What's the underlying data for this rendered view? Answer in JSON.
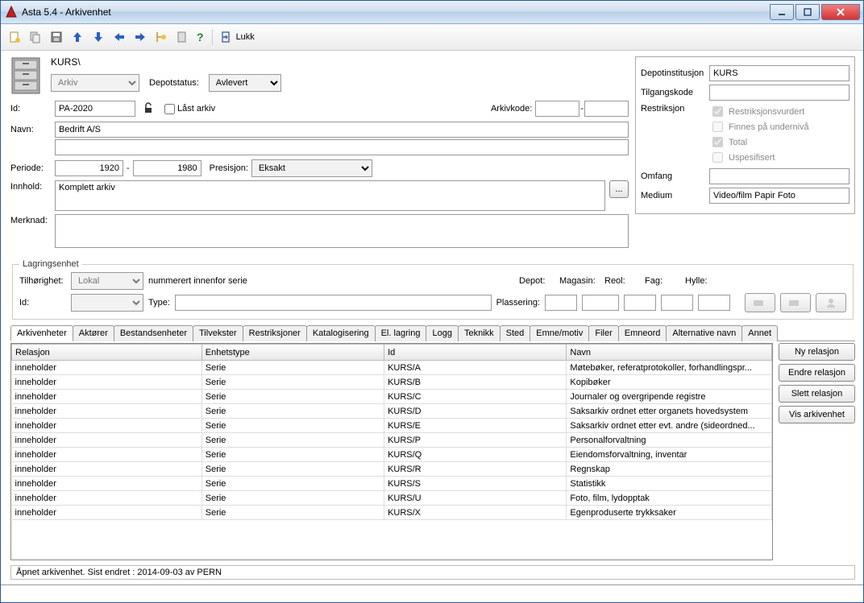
{
  "window": {
    "title": "Asta 5.4 - Arkivenhet"
  },
  "toolbar": {
    "close_label": "Lukk"
  },
  "main": {
    "breadcrumb": "KURS\\",
    "type_select": "Arkiv",
    "depotstatus_label": "Depotstatus:",
    "depotstatus_value": "Avlevert",
    "id_label": "Id:",
    "id_value": "PA-2020",
    "locked_label": "Låst arkiv",
    "arkivkode_label": "Arkivkode:",
    "navn_label": "Navn:",
    "navn_value": "Bedrift A/S",
    "periode_label": "Periode:",
    "periode_from": "1920",
    "periode_sep": "-",
    "periode_to": "1980",
    "presisjon_label": "Presisjon:",
    "presisjon_value": "Eksakt",
    "innhold_label": "Innhold:",
    "innhold_value": "Komplett arkiv",
    "merknad_label": "Merknad:"
  },
  "right": {
    "depotinst_label": "Depotinstitusjon",
    "depotinst_value": "KURS",
    "tilgang_label": "Tilgangskode",
    "restriksjon_label": "Restriksjon",
    "chk_restr": "Restriksjonsvurdert",
    "chk_finnes": "Finnes på undernivå",
    "chk_total": "Total",
    "chk_uspes": "Uspesifisert",
    "omfang_label": "Omfang",
    "medium_label": "Medium",
    "medium_value": "Video/film Papir Foto"
  },
  "lagring": {
    "legend": "Lagringsenhet",
    "tilh_label": "Tilhørighet:",
    "tilh_value": "Lokal",
    "nummerert": "nummerert innenfor serie",
    "id_label": "Id:",
    "type_label": "Type:",
    "plassering_label": "Plassering:",
    "depot_label": "Depot:",
    "magasin_label": "Magasin:",
    "reol_label": "Reol:",
    "fag_label": "Fag:",
    "hylle_label": "Hylle:"
  },
  "tabs": [
    "Arkivenheter",
    "Aktører",
    "Bestandsenheter",
    "Tilvekster",
    "Restriksjoner",
    "Katalogisering",
    "El. lagring",
    "Logg",
    "Teknikk",
    "Sted",
    "Emne/motiv",
    "Filer",
    "Emneord",
    "Alternative navn",
    "Annet"
  ],
  "grid": {
    "columns": [
      "Relasjon",
      "Enhetstype",
      "Id",
      "Navn"
    ],
    "rows": [
      {
        "rel": "inneholder",
        "type": "Serie",
        "id": "KURS/A",
        "navn": "Møtebøker, referatprotokoller, forhandlingspr..."
      },
      {
        "rel": "inneholder",
        "type": "Serie",
        "id": "KURS/B",
        "navn": "Kopibøker"
      },
      {
        "rel": "inneholder",
        "type": "Serie",
        "id": "KURS/C",
        "navn": "Journaler og overgripende registre"
      },
      {
        "rel": "inneholder",
        "type": "Serie",
        "id": "KURS/D",
        "navn": "Saksarkiv ordnet etter organets hovedsystem"
      },
      {
        "rel": "inneholder",
        "type": "Serie",
        "id": "KURS/E",
        "navn": "Saksarkiv ordnet etter evt. andre (sideordned..."
      },
      {
        "rel": "inneholder",
        "type": "Serie",
        "id": "KURS/P",
        "navn": "Personalforvaltning"
      },
      {
        "rel": "inneholder",
        "type": "Serie",
        "id": "KURS/Q",
        "navn": "Eiendomsforvaltning, inventar"
      },
      {
        "rel": "inneholder",
        "type": "Serie",
        "id": "KURS/R",
        "navn": "Regnskap"
      },
      {
        "rel": "inneholder",
        "type": "Serie",
        "id": "KURS/S",
        "navn": "Statistikk"
      },
      {
        "rel": "inneholder",
        "type": "Serie",
        "id": "KURS/U",
        "navn": "Foto, film, lydopptak"
      },
      {
        "rel": "inneholder",
        "type": "Serie",
        "id": "KURS/X",
        "navn": "Egenproduserte trykksaker"
      }
    ]
  },
  "sidebtns": {
    "ny": "Ny relasjon",
    "endre": "Endre relasjon",
    "slett": "Slett relasjon",
    "vis": "Vis arkivenhet"
  },
  "status": "Åpnet arkivenhet. Sist endret : 2014-09-03 av PERN"
}
